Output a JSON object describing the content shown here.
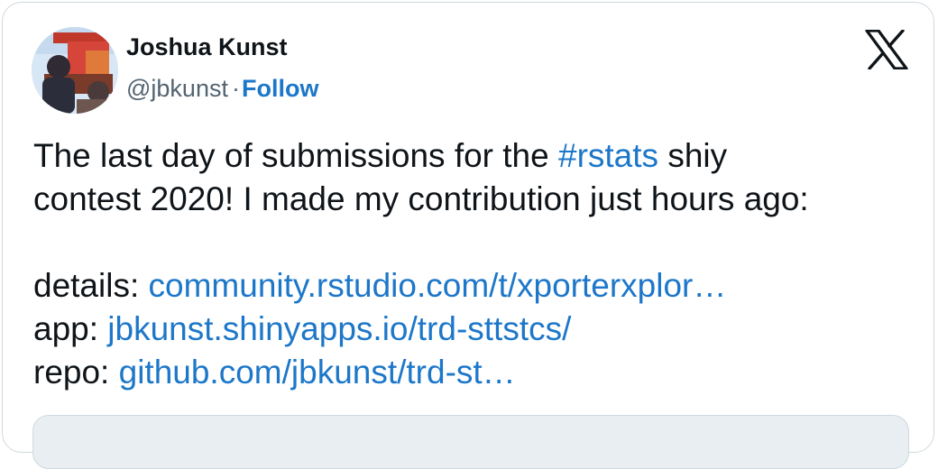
{
  "author": {
    "name": "Joshua Kunst",
    "handle": "@jbkunst",
    "separator": "·",
    "follow_label": "Follow"
  },
  "brand": {
    "logo_icon": "x-logo-icon"
  },
  "tweet": {
    "line1_text": "The last day of submissions for the ",
    "hashtag": "#rstats",
    "line1_after": " shiy",
    "line2_text": "contest 2020! I made my contribution just hours ago:",
    "details_label": "details: ",
    "details_link": "community.rstudio.com/t/xporterxplor…",
    "app_label": "app: ",
    "app_link": "jbkunst.shinyapps.io/trd-sttstcs/",
    "repo_label": "repo: ",
    "repo_link": "github.com/jbkunst/trd-st…"
  },
  "colors": {
    "link": "#1d77c9",
    "text": "#0f1419",
    "secondary": "#536471",
    "border": "#cfd9de"
  }
}
